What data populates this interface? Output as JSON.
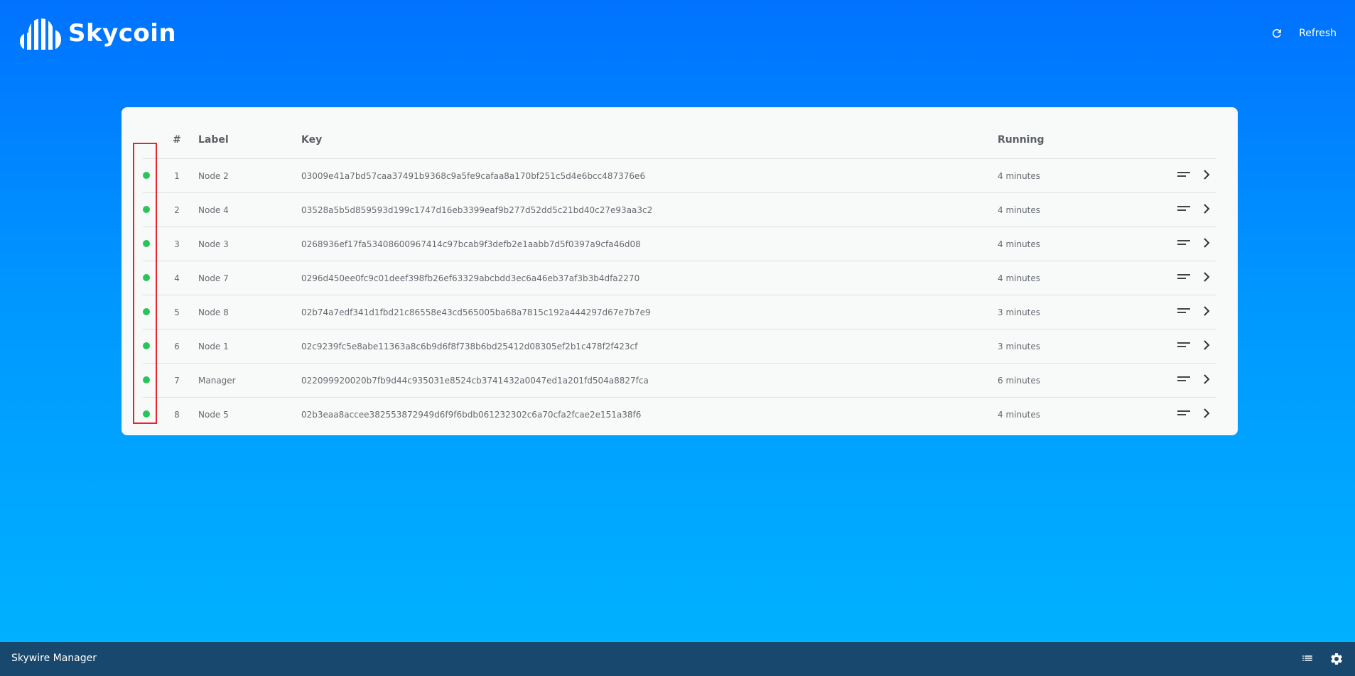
{
  "header": {
    "brand": "Skycoin",
    "refresh_label": "Refresh"
  },
  "table": {
    "columns": {
      "num": "#",
      "label": "Label",
      "key": "Key",
      "running": "Running"
    },
    "rows": [
      {
        "num": "1",
        "label": "Node 2",
        "key": "03009e41a7bd57caa37491b9368c9a5fe9cafaa8a170bf251c5d4e6bcc487376e6",
        "running": "4 minutes",
        "status": "online"
      },
      {
        "num": "2",
        "label": "Node 4",
        "key": "03528a5b5d859593d199c1747d16eb3399eaf9b277d52dd5c21bd40c27e93aa3c2",
        "running": "4 minutes",
        "status": "online"
      },
      {
        "num": "3",
        "label": "Node 3",
        "key": "0268936ef17fa53408600967414c97bcab9f3defb2e1aabb7d5f0397a9cfa46d08",
        "running": "4 minutes",
        "status": "online"
      },
      {
        "num": "4",
        "label": "Node 7",
        "key": "0296d450ee0fc9c01deef398fb26ef63329abcbdd3ec6a46eb37af3b3b4dfa2270",
        "running": "4 minutes",
        "status": "online"
      },
      {
        "num": "5",
        "label": "Node 8",
        "key": "02b74a7edf341d1fbd21c86558e43cd565005ba68a7815c192a444297d67e7b7e9",
        "running": "3 minutes",
        "status": "online"
      },
      {
        "num": "6",
        "label": "Node 1",
        "key": "02c9239fc5e8abe11363a8c6b9d6f8f738b6bd25412d08305ef2b1c478f2f423cf",
        "running": "3 minutes",
        "status": "online"
      },
      {
        "num": "7",
        "label": "Manager",
        "key": "022099920020b7fb9d44c935031e8524cb3741432a0047ed1a201fd504a8827fca",
        "running": "6 minutes",
        "status": "online"
      },
      {
        "num": "8",
        "label": "Node 5",
        "key": "02b3eaa8accee382553872949d6f9f6bdb061232302c6a70cfa2fcae2e151a38f6",
        "running": "4 minutes",
        "status": "online"
      }
    ]
  },
  "footer": {
    "title": "Skywire Manager",
    "icons": [
      "list-icon",
      "settings-icon"
    ]
  },
  "colors": {
    "status_online": "#29c55a",
    "footer_bg": "#19486e",
    "highlight": "#e8242a"
  }
}
